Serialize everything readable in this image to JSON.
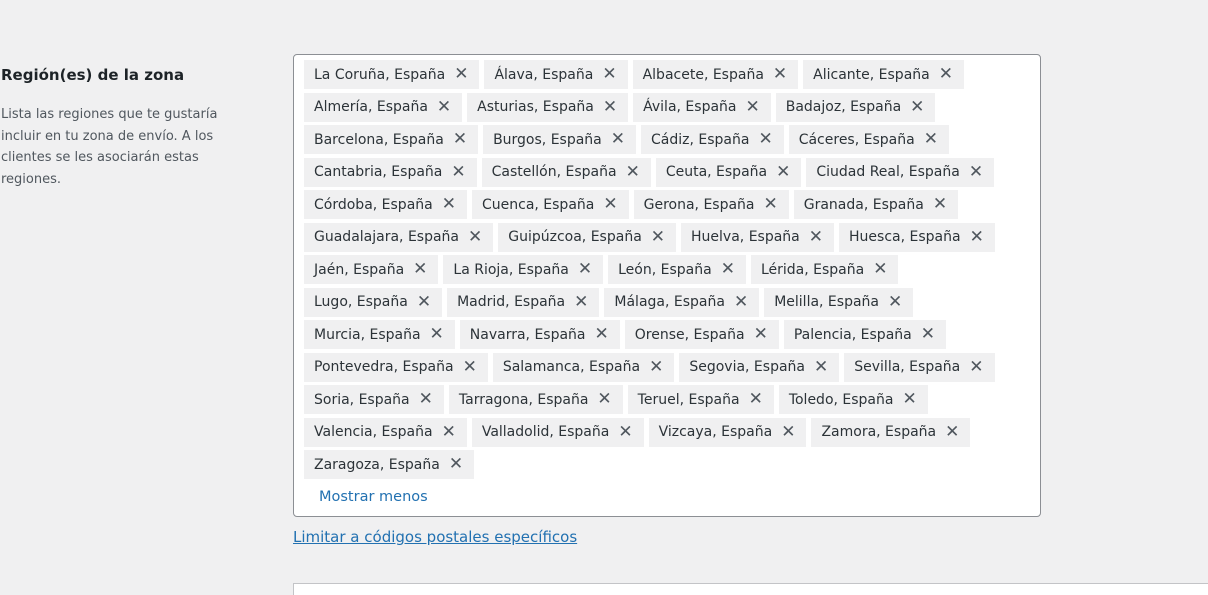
{
  "section": {
    "title": "Región(es) de la zona",
    "description": "Lista las regiones que te gustaría incluir en tu zona de envío. A los clientes se les asociarán estas regiones."
  },
  "regions": [
    "La Coruña, España",
    "Álava, España",
    "Albacete, España",
    "Alicante, España",
    "Almería, España",
    "Asturias, España",
    "Ávila, España",
    "Badajoz, España",
    "Barcelona, España",
    "Burgos, España",
    "Cádiz, España",
    "Cáceres, España",
    "Cantabria, España",
    "Castellón, España",
    "Ceuta, España",
    "Ciudad Real, España",
    "Córdoba, España",
    "Cuenca, España",
    "Gerona, España",
    "Granada, España",
    "Guadalajara, España",
    "Guipúzcoa, España",
    "Huelva, España",
    "Huesca, España",
    "Jaén, España",
    "La Rioja, España",
    "León, España",
    "Lérida, España",
    "Lugo, España",
    "Madrid, España",
    "Málaga, España",
    "Melilla, España",
    "Murcia, España",
    "Navarra, España",
    "Orense, España",
    "Palencia, España",
    "Pontevedra, España",
    "Salamanca, España",
    "Segovia, España",
    "Sevilla, España",
    "Soria, España",
    "Tarragona, España",
    "Teruel, España",
    "Toledo, España",
    "Valencia, España",
    "Valladolid, España",
    "Vizcaya, España",
    "Zamora, España",
    "Zaragoza, España"
  ],
  "remove_glyph": "✕",
  "remove_icon": "close-icon",
  "show_less_label": "Mostrar menos",
  "postcode_link_label": "Limitar a códigos postales específicos",
  "colors": {
    "link": "#2271b1",
    "tag_bg": "#f0f0f1",
    "page_bg": "#f0f0f1"
  }
}
